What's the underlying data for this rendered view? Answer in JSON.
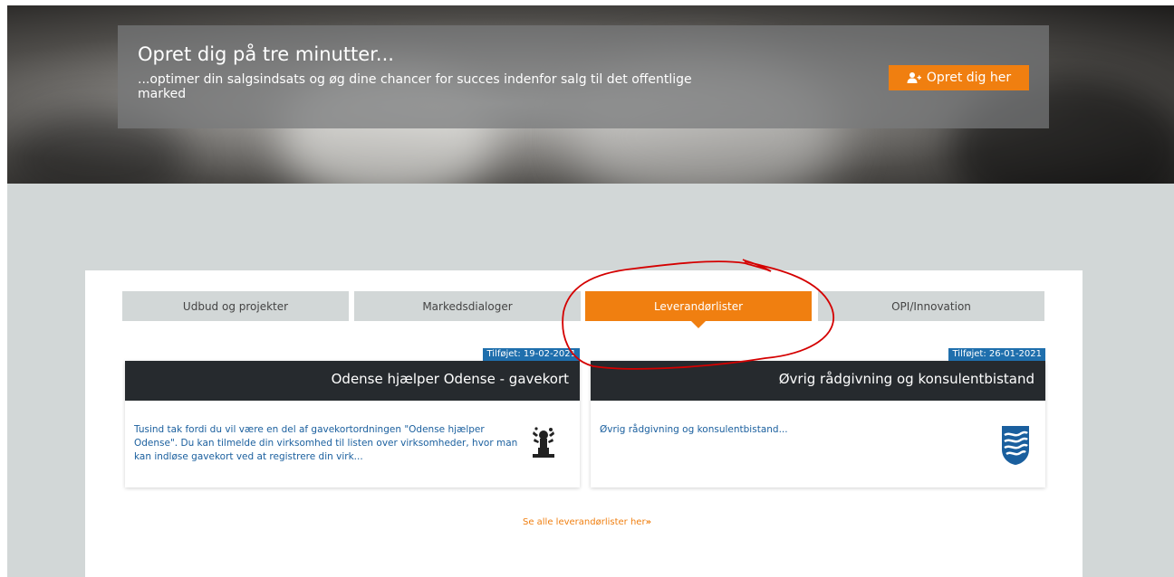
{
  "promo": {
    "title": "Opret dig på tre minutter...",
    "text": "...optimer din salgsindsats og øg dine chancer for succes indenfor salg til det offentlige marked",
    "button_label": "Opret dig her",
    "button_icon": "add-user-icon"
  },
  "tabs": [
    {
      "label": "Udbud og projekter",
      "active": false
    },
    {
      "label": "Markedsdialoger",
      "active": false
    },
    {
      "label": "Leverandørlister",
      "active": true
    },
    {
      "label": "OPI/Innovation",
      "active": false
    }
  ],
  "cards": [
    {
      "badge": "Tilføjet: 19-02-2021",
      "title": "Odense hjælper Odense - gavekort",
      "text": "Tusind tak fordi du vil være en del af gavekortordningen \"Odense hjælper Odense\". Du kan tilmelde din virksomhed til listen over virksomheder, hvor man kan indløse gavekort ved at registrere din virk...",
      "logo": "odense-municipality-logo"
    },
    {
      "badge": "Tilføjet: 26-01-2021",
      "title": "Øvrig rådgivning og konsulentbistand",
      "text": "Øvrig rådgivning og konsulentbistand...",
      "logo": "wave-shield-logo"
    }
  ],
  "see_all": {
    "label": "Se alle leverandørlister her",
    "icon": "double-chevron-right-icon"
  },
  "colors": {
    "accent": "#f07f10",
    "dark_header": "#262a2e",
    "badge": "#1f6fad",
    "link": "#1a5f9e",
    "annotation": "#d40000"
  }
}
